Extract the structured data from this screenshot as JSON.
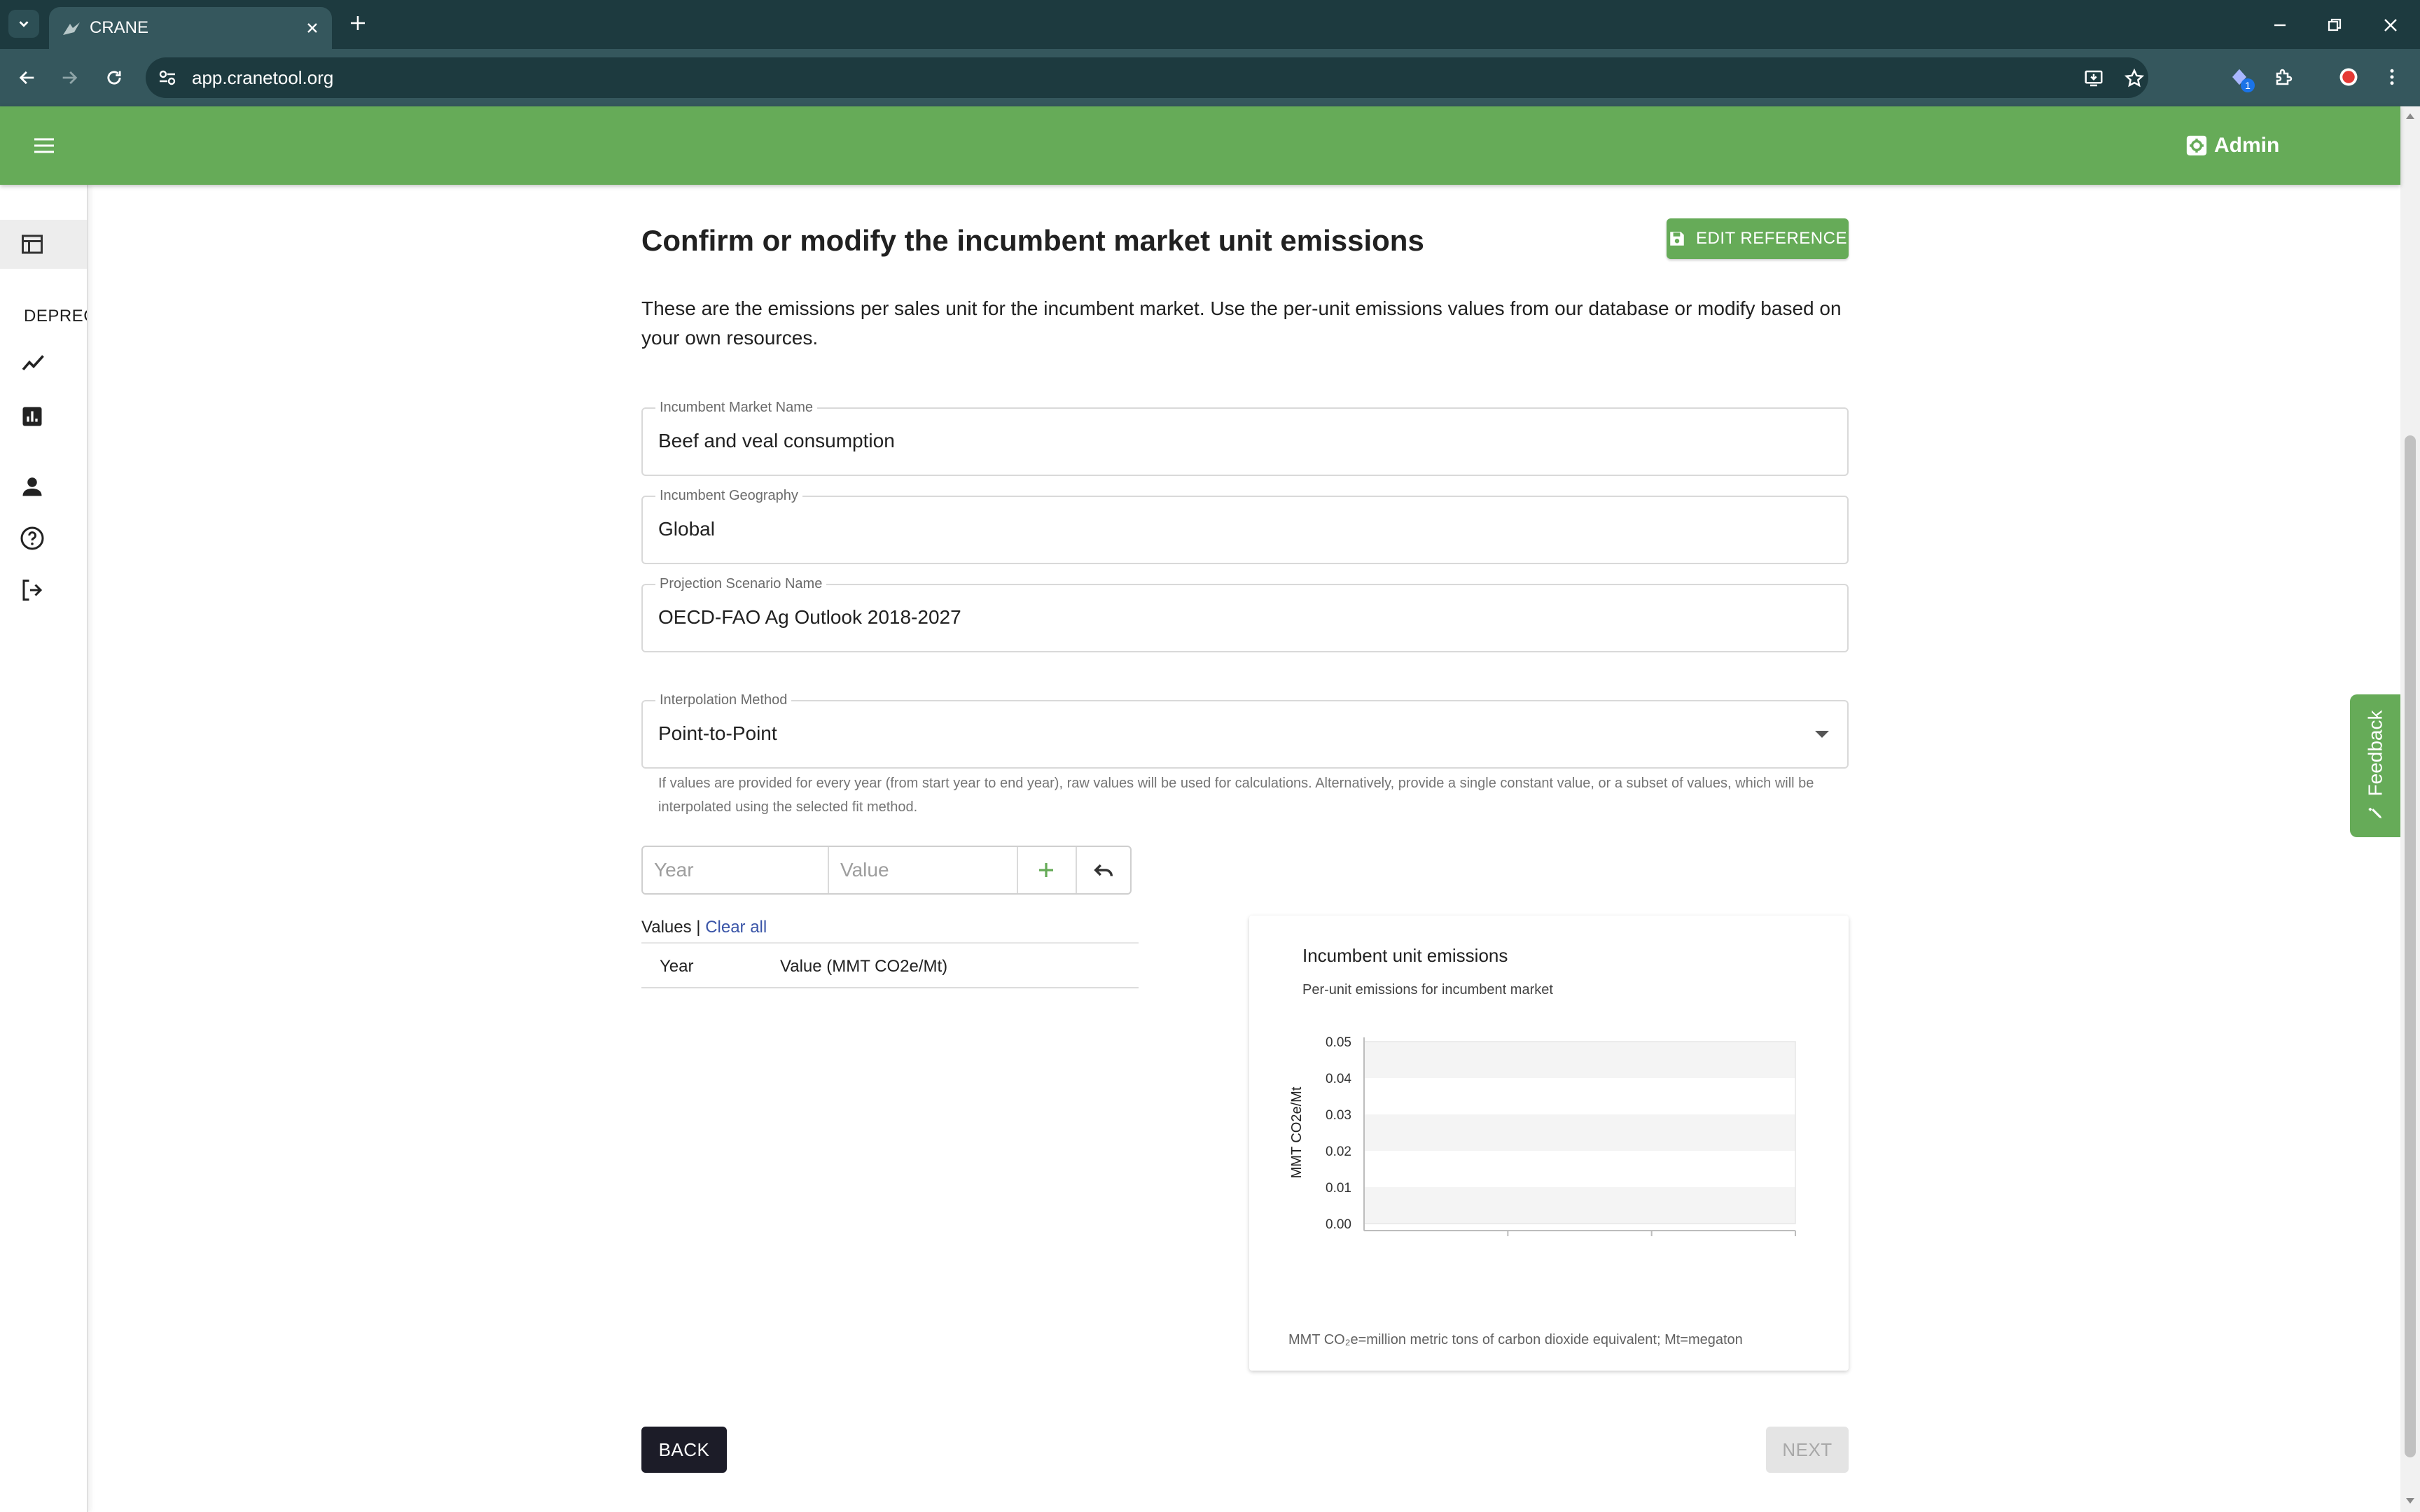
{
  "browser": {
    "tab_title": "CRANE",
    "url": "app.cranetool.org",
    "extension_badge": "1"
  },
  "header": {
    "admin_label": "Admin"
  },
  "sidebar": {
    "section_label": "DEPRECATED",
    "items": [
      {
        "icon": "table-icon",
        "active": true
      },
      {
        "icon": "trending-line-icon"
      },
      {
        "icon": "bar-chart-icon"
      },
      {
        "icon": "person-icon"
      },
      {
        "icon": "help-circle-icon"
      },
      {
        "icon": "logout-icon"
      }
    ]
  },
  "feedback": {
    "label": "Feedback"
  },
  "main": {
    "title": "Confirm or modify the incumbent market unit emissions",
    "edit_reference_label": "EDIT REFERENCE",
    "description": "These are the emissions per sales unit for the incumbent market. Use the per-unit emissions values from our database or modify based on your own resources.",
    "fields": {
      "market_name": {
        "label": "Incumbent Market Name",
        "value": "Beef and veal consumption"
      },
      "geography": {
        "label": "Incumbent Geography",
        "value": "Global"
      },
      "scenario": {
        "label": "Projection Scenario Name",
        "value": "OECD-FAO Ag Outlook 2018-2027"
      },
      "interpolation": {
        "label": "Interpolation Method",
        "value": "Point-to-Point"
      }
    },
    "helper_text": "If values are provided for every year (from start year to end year), raw values will be used for calculations. Alternatively, provide a single constant value, or a subset of values, which will be interpolated using the selected fit method.",
    "entry": {
      "year_placeholder": "Year",
      "value_placeholder": "Value"
    },
    "values": {
      "label": "Values |",
      "clear_all": "Clear all",
      "columns": [
        "Year",
        "Value (MMT CO2e/Mt)"
      ],
      "rows": []
    },
    "back_label": "BACK",
    "next_label": "NEXT"
  },
  "chart_data": {
    "type": "line",
    "title": "Incumbent unit emissions",
    "subtitle": "Per-unit emissions for incumbent market",
    "ylabel": "MMT CO2e/Mt",
    "xlabel": "",
    "ylim": [
      0,
      0.05
    ],
    "yticks": [
      "0.00",
      "0.01",
      "0.02",
      "0.03",
      "0.04",
      "0.05"
    ],
    "series": [],
    "footnote": "MMT CO₂e=million metric tons of carbon dioxide equivalent; Mt=megaton"
  },
  "colors": {
    "brand_green": "#66ab58",
    "chrome_dark": "#1d3a3f",
    "chrome_mid": "#35575d",
    "link_blue": "#3a55a8"
  }
}
